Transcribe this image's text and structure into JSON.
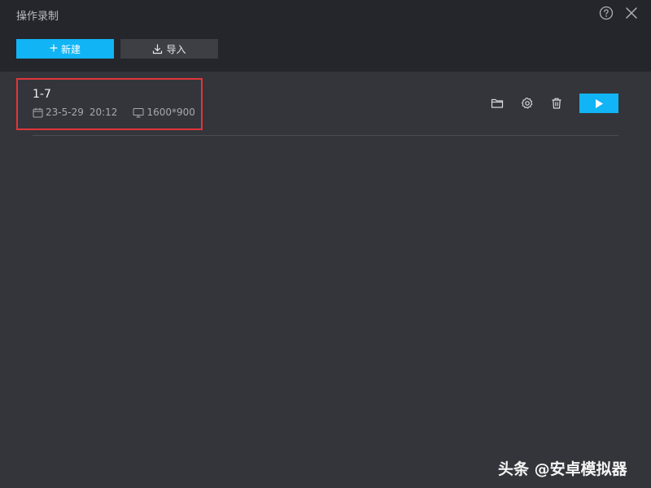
{
  "window": {
    "title": "操作录制"
  },
  "toolbar": {
    "new_label": "新建",
    "import_label": "导入"
  },
  "records": [
    {
      "name": "1-7",
      "date": "23-5-29",
      "time": "20:12",
      "resolution": "1600*900"
    }
  ],
  "icons": {
    "help": "help-icon",
    "close": "close-icon",
    "plus": "plus-icon",
    "download": "download-icon",
    "calendar": "calendar-icon",
    "monitor": "monitor-icon",
    "folder": "folder-icon",
    "settings": "gear-icon",
    "delete": "trash-icon",
    "play": "play-icon"
  },
  "colors": {
    "accent": "#11b4f4",
    "background": "#34353b",
    "header": "#25262b",
    "highlight_border": "#e0353a"
  },
  "watermark": {
    "text": "头条 @安卓模拟器"
  }
}
